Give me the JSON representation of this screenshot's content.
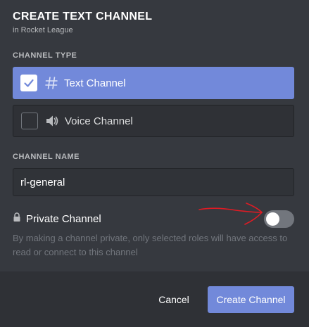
{
  "modal": {
    "title": "CREATE TEXT CHANNEL",
    "subtitle": "in Rocket League"
  },
  "channel_type": {
    "label": "CHANNEL TYPE",
    "options": [
      {
        "label": "Text Channel",
        "icon": "hash-icon",
        "selected": true
      },
      {
        "label": "Voice Channel",
        "icon": "speaker-icon",
        "selected": false
      }
    ]
  },
  "channel_name": {
    "label": "CHANNEL NAME",
    "value": "rl-general"
  },
  "private": {
    "label": "Private Channel",
    "icon": "lock-icon",
    "enabled": false,
    "description": "By making a channel private, only selected roles will have access to read or connect to this channel"
  },
  "footer": {
    "cancel_label": "Cancel",
    "create_label": "Create Channel"
  },
  "colors": {
    "background": "#36393f",
    "footer": "#2f3136",
    "accent": "#7289da",
    "annotation": "#e01b24"
  }
}
